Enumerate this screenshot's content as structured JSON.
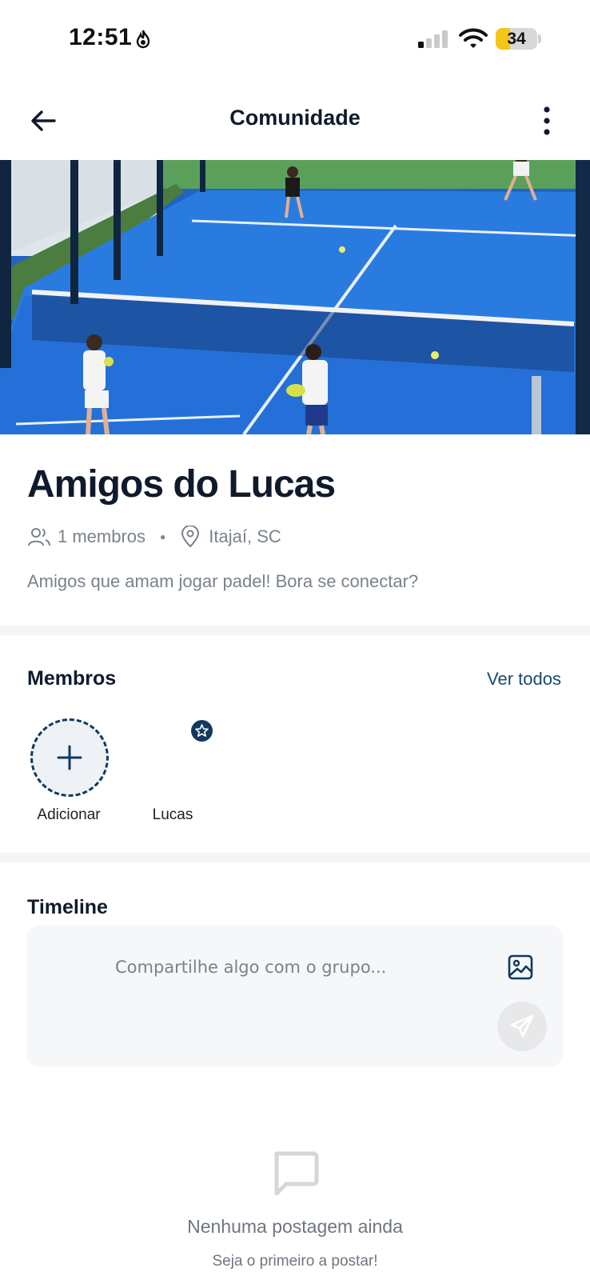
{
  "status_bar": {
    "time": "12:51",
    "battery_level": "34",
    "battery_fraction": 0.34,
    "icons": [
      "flame-icon",
      "signal-icon",
      "wifi-icon",
      "battery-icon"
    ]
  },
  "header": {
    "title": "Comunidade",
    "back_icon": "arrow-left-icon",
    "menu_icon": "more-vertical-icon"
  },
  "group": {
    "name": "Amigos do Lucas",
    "members_count": "1 membros",
    "location": "Itajaí, SC",
    "description": "Amigos que amam jogar padel! Bora se conectar?"
  },
  "members": {
    "title": "Membros",
    "see_all": "Ver todos",
    "add_label": "Adicionar",
    "list": [
      {
        "name": "Lucas"
      }
    ]
  },
  "timeline": {
    "title": "Timeline",
    "placeholder": "Compartilhe algo com o grupo...",
    "empty_title": "Nenhuma postagem ainda",
    "empty_subtitle": "Seja o primeiro a postar!"
  },
  "colors": {
    "primary": "#12395e",
    "court_blue": "#1f6fd6",
    "text_muted": "#7a828c"
  }
}
